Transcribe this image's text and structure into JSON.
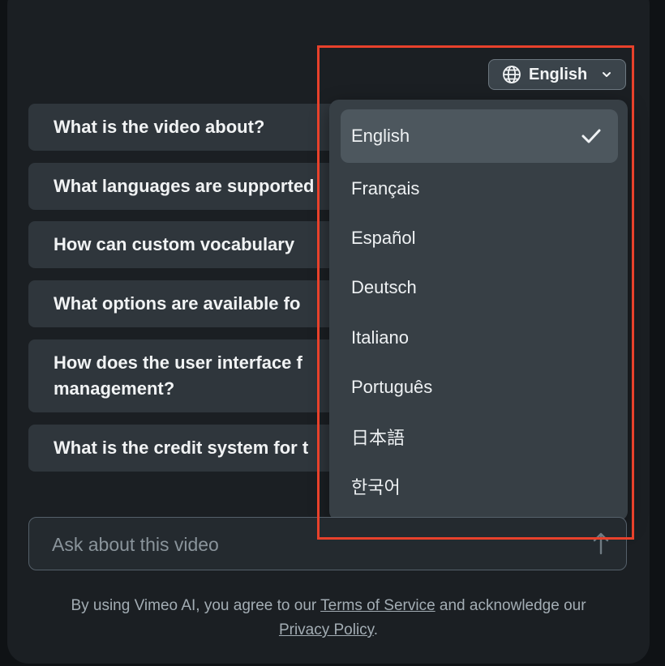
{
  "language_toggle": {
    "label": "English",
    "icon": "globe-icon",
    "chevron": "chevron-down-icon"
  },
  "questions": [
    "What is the video about?",
    "What languages are supported",
    "How can custom vocabulary",
    "What options are available fo",
    "How does the user interface f management?",
    "What is the credit system for t"
  ],
  "language_menu": {
    "options": [
      "English",
      "Français",
      "Español",
      "Deutsch",
      "Italiano",
      "Português",
      "日本語",
      "한국어"
    ],
    "selected": "English",
    "selected_icon": "checkmark-icon"
  },
  "ask": {
    "placeholder": "Ask about this video",
    "value": "",
    "send_icon": "arrow-up-icon"
  },
  "disclaimer": {
    "prefix": "By using Vimeo AI, you agree to our ",
    "terms_link": "Terms of Service",
    "middle": " and acknowledge our ",
    "privacy_link": "Privacy Policy",
    "suffix": "."
  },
  "colors": {
    "highlight_border": "#e8412b",
    "panel_background": "#1b1f23",
    "dropdown_background": "#373f45",
    "question_background": "#2f363c"
  }
}
